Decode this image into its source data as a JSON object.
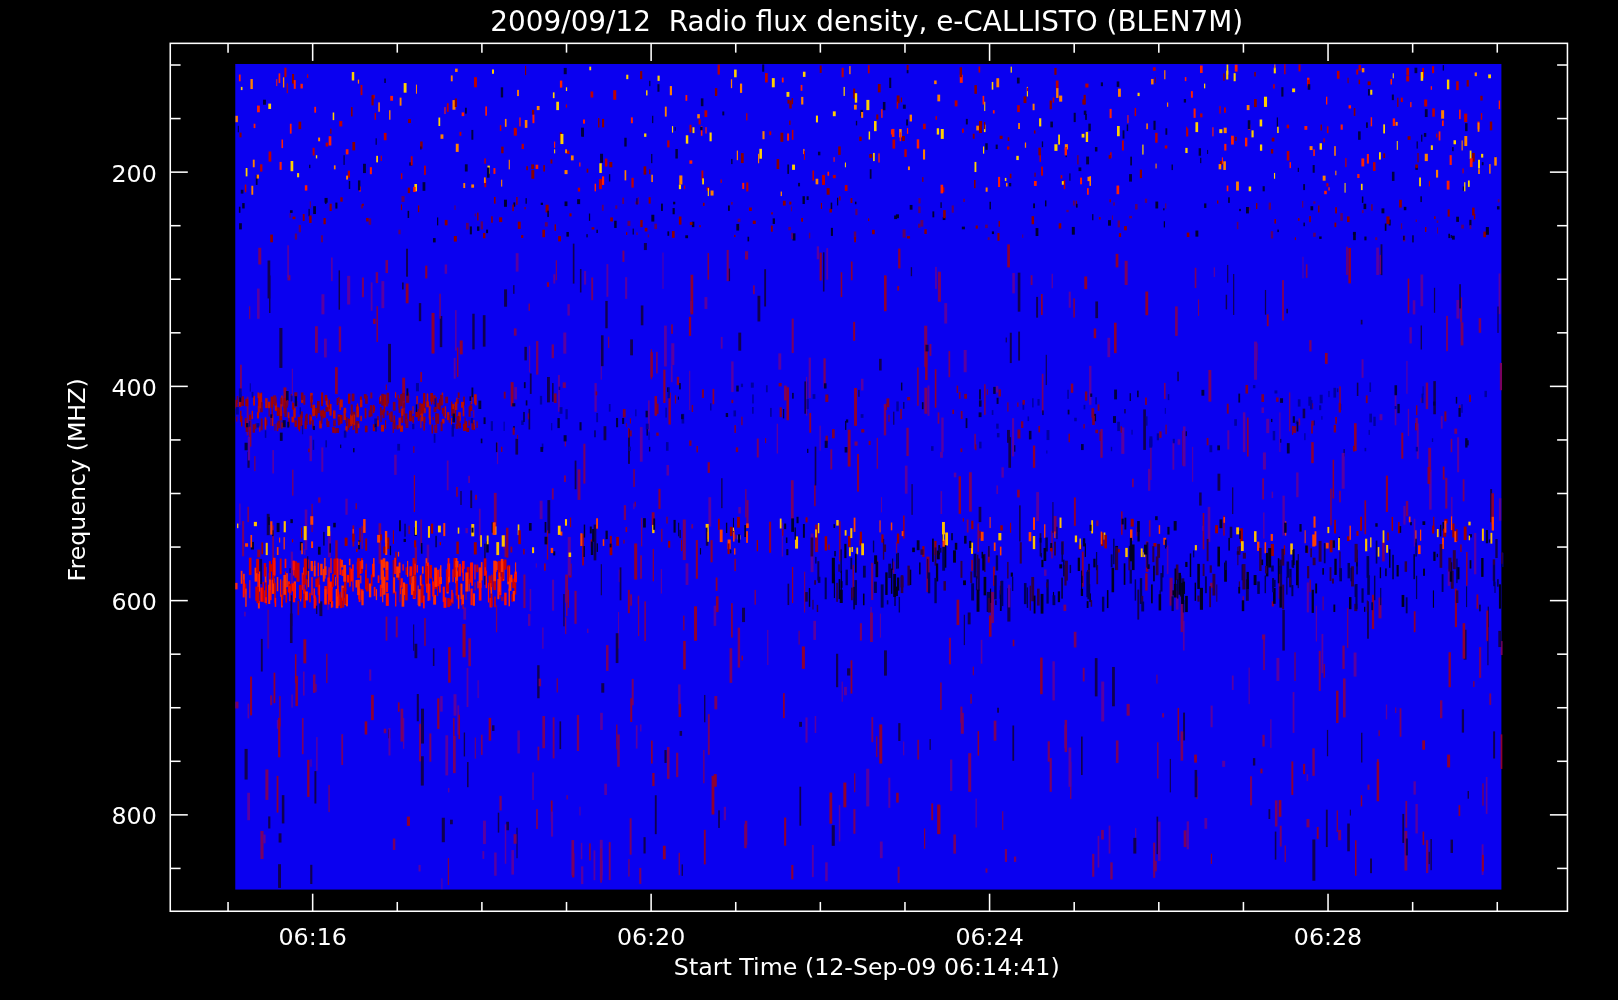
{
  "title": "2009/09/12  Radio flux density, e-CALLISTO (BLEN7M)",
  "y_axis": {
    "label": "Frequency (MHZ)",
    "ticks": [
      "200",
      "400",
      "600",
      "800"
    ]
  },
  "x_axis": {
    "label": "Start Time (12-Sep-09 06:14:41)",
    "ticks": [
      "06:16",
      "06:20",
      "06:24",
      "06:28"
    ]
  }
}
